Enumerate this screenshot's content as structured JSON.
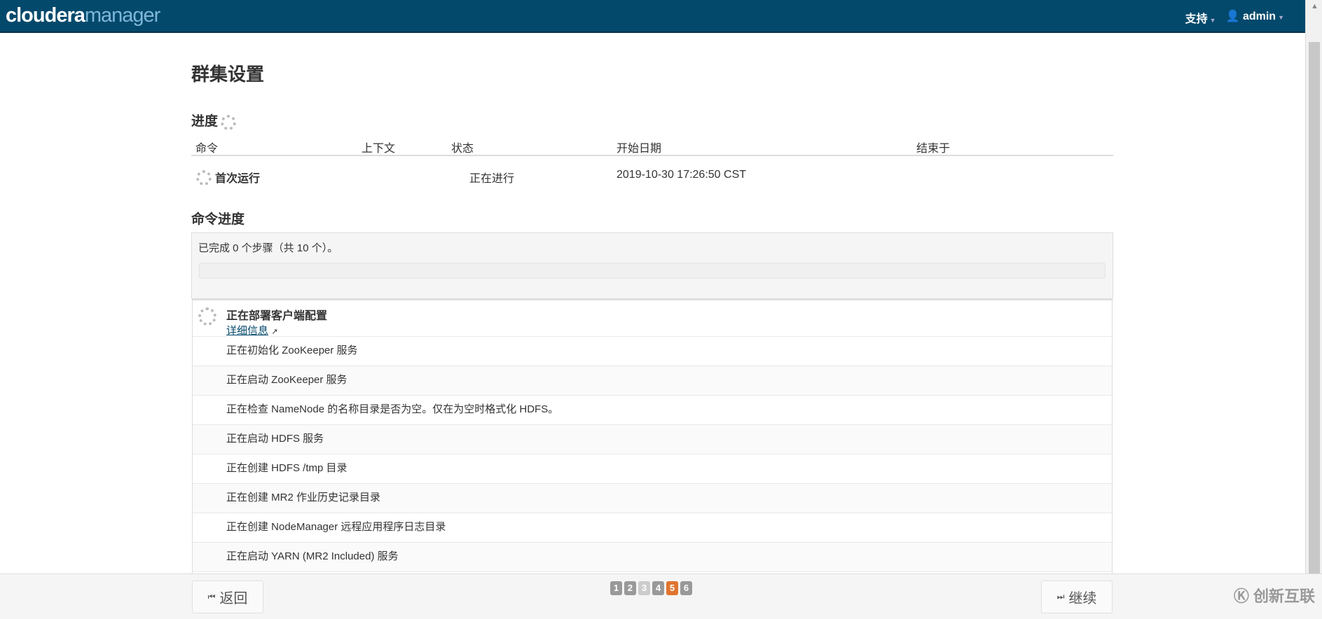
{
  "header": {
    "logo_a": "cloudera",
    "logo_b": "manager",
    "support": "支持",
    "user": "admin"
  },
  "title": "群集设置",
  "progress": {
    "heading": "进度",
    "columns": [
      "命令",
      "上下文",
      "状态",
      "开始日期",
      "结束于"
    ],
    "row": {
      "command": "首次运行",
      "context": "",
      "status": "正在进行",
      "start": "2019-10-30 17:26:50 CST",
      "end": ""
    }
  },
  "command_progress": {
    "heading": "命令进度",
    "summary": "已完成 0 个步骤（共 10 个）。",
    "progress_percent": 0,
    "current_step": "正在部署客户端配置",
    "details_link": "详细信息",
    "steps": [
      "正在初始化 ZooKeeper 服务",
      "正在启动 ZooKeeper 服务",
      "正在检查 NameNode 的名称目录是否为空。仅在为空时格式化 HDFS。",
      "正在启动 HDFS 服务",
      "正在创建 HDFS /tmp 目录",
      "正在创建 MR2 作业历史记录目录",
      "正在创建 NodeManager 远程应用程序日志目录",
      "正在启动 YARN (MR2 Included) 服务"
    ]
  },
  "footer": {
    "back": "返回",
    "continue": "继续",
    "pages": [
      "1",
      "2",
      "3",
      "4",
      "5",
      "6"
    ],
    "current_page": "5",
    "disabled_page": "3",
    "watermark": "创新互联"
  }
}
